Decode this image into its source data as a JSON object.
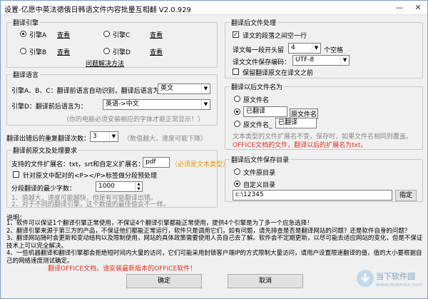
{
  "window": {
    "title": "设置-亿愿中英法德俄日韩语文件内容批量互相翻 V2.0.929",
    "minimize": "—",
    "close": "✕"
  },
  "engine": {
    "title": "翻译引擎",
    "a_label": "引擎A",
    "b_label": "引擎B",
    "c_label": "引擎C",
    "d_label": "引擎D",
    "view": "查看",
    "explain": "问题解决方法",
    "selected": "A"
  },
  "language": {
    "title": "翻译语言",
    "abc_text": "引擎A、B、C：翻译前语言自动识别，翻译后语言为：",
    "abc_value": "英文",
    "d_text": "引擎D：翻译前后语言为：",
    "d_value": "英语->中文",
    "note": "（你的电脑必须安装相应的字体才能正常显示！）"
  },
  "retry": {
    "label": "翻译出错后的重复翻译次数：",
    "value": "3",
    "note": "（数值越大，速度可能下降）"
  },
  "pre": {
    "title": "翻译前原文及处理要求",
    "ext_label": "支持的文件扩展名：txt，srt和自定义扩展名：",
    "ext_value": "pdf",
    "ext_note": "（必须是文本类型）",
    "p_check_label": "针对原文中配对的<P></P>标签做分段预处理",
    "min_len_label": "分段翻译的最少字数：",
    "min_len_value": "1000",
    "note1": "1、值越大，速度可能越快，但是有可能翻译出错。",
    "note2": "2、对于不同的翻译引擎，这个数值的最佳值会不一样。"
  },
  "post": {
    "title": "翻译后文件处理",
    "blank_line_label": "译文的段落之间空一行",
    "indent_label": "译文每一段开头留",
    "indent_value": "4",
    "indent_unit": "个空格",
    "encoding_label": "译文文件保存编码：",
    "encoding_value": "UTF-8",
    "keep_original_label": "保留翻译原文在译文之前",
    "blank_line_checked": true,
    "keep_original_checked": false
  },
  "naming": {
    "title": "翻译以后文件名为",
    "opt1": "原文件名",
    "opt2_prefix": "已翻译",
    "opt2_suffix": "原文件名",
    "opt3_prefix": "原文件名_",
    "opt3_suffix": "已翻译",
    "note": "文本类型的文件扩展名不变，保存时，如果文件名相同则覆盖。",
    "office_note": "OFFICE文档的文件，翻译以后的扩展名为txt。",
    "selected": 2
  },
  "save_dir": {
    "title": "翻译后文件保存目录",
    "opt1": "文件原目录",
    "opt2": "自定义目录",
    "path": "c:\\12345",
    "browse": "指定",
    "selected": 2
  },
  "notes": {
    "title": "说明：",
    "line1": "1、软件可以保证1个翻译引擎正常使用，不保证4个翻译引擎都能正常使用，提供4个引擎是为了多一个应急选择！",
    "line2": "2、翻译引擎来源于第三方的产品，不保证他们都能正常运行，软件只是调用它们，如有问题，请先排查是否是翻译网站的问题？还是软件自身的问题？",
    "line3": "3、翻译网站随时会更新和变动结构以及限制使用，网站的具体政策需要使用人员自己去了解。软件会不定期更新，以尽可能去适应网站的变化，但是不保证技术上可以完全解决。",
    "line4": "4、一些机器翻译和翻译引擎都会拒绝短时间内大量的访问，它们可能采用封锁客户端IP的方式限制大量访问，请用户设置限速翻译的值，值的大小要根据自己的网络速度测试确定。",
    "office": "翻译OFFICE文档，请安装最新版本的OFFICE软件！"
  },
  "buttons": {
    "ok": "确定",
    "cancel": "取消"
  },
  "watermark": {
    "text": "当下软件园",
    "url": "www.downxia.com"
  }
}
